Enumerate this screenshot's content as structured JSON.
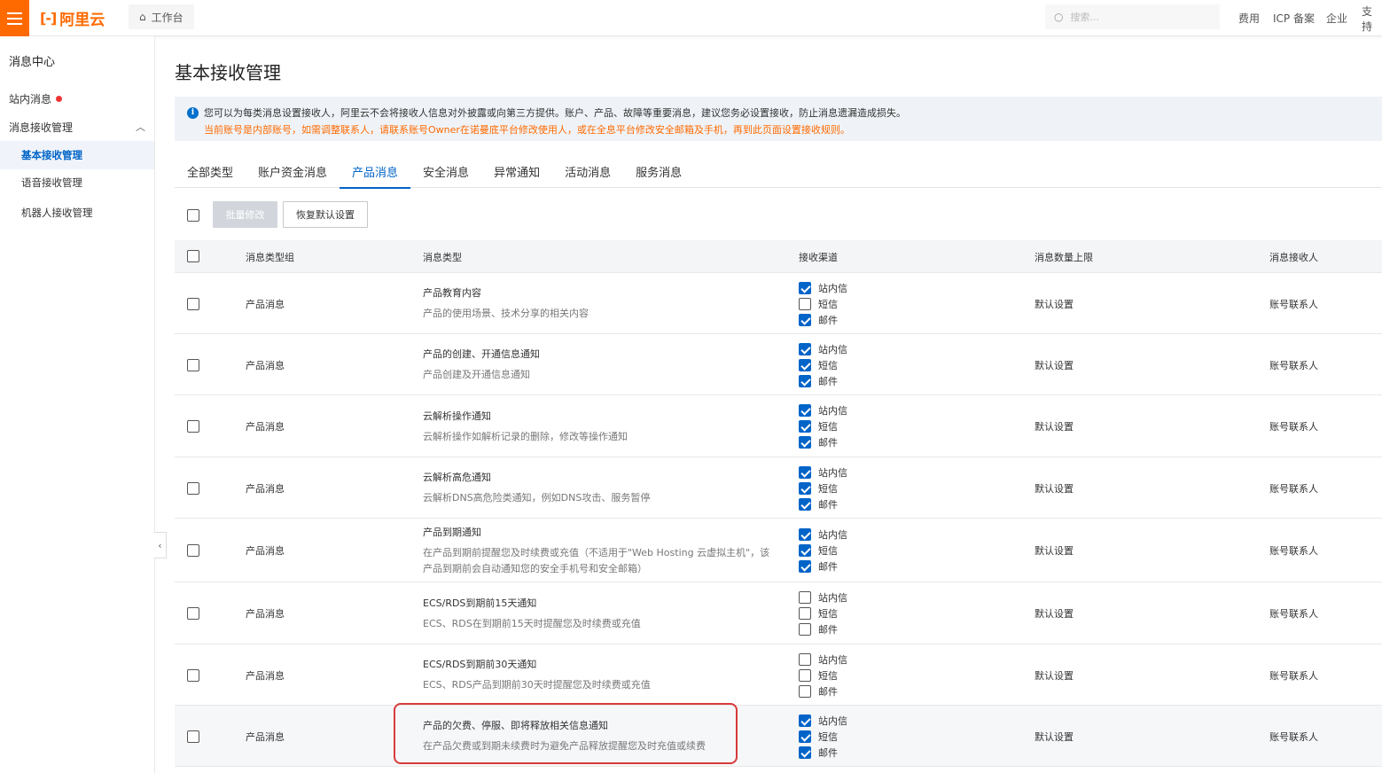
{
  "topbar": {
    "logo_text": "阿里云",
    "logo_mark": "[-]",
    "workbench": "工作台",
    "search_placeholder": "搜索...",
    "links": [
      "费用",
      "ICP 备案",
      "企业",
      "支持"
    ]
  },
  "sidebar": {
    "title": "消息中心",
    "inbox": "站内消息",
    "group": "消息接收管理",
    "items": [
      "基本接收管理",
      "语音接收管理",
      "机器人接收管理"
    ]
  },
  "page": {
    "title": "基本接收管理",
    "notice_line1": "您可以为每类消息设置接收人，阿里云不会将接收人信息对外披露或向第三方提供。账户、产品、故障等重要消息，建议您务必设置接收，防止消息遗漏造成损失。",
    "notice_line2": "当前账号是内部账号，如需调整联系人，请联系账号Owner在诺曼底平台修改使用人，或在全息平台修改安全邮箱及手机，再到此页面设置接收规则。"
  },
  "tabs": [
    "全部类型",
    "账户资金消息",
    "产品消息",
    "安全消息",
    "异常通知",
    "活动消息",
    "服务消息"
  ],
  "active_tab": "产品消息",
  "toolbar": {
    "batch_edit": "批量修改",
    "restore_default": "恢复默认设置"
  },
  "table": {
    "headers": [
      "消息类型组",
      "消息类型",
      "接收渠道",
      "消息数量上限",
      "消息接收人"
    ],
    "channels": [
      "站内信",
      "短信",
      "邮件"
    ],
    "rows": [
      {
        "group": "产品消息",
        "title": "产品教育内容",
        "desc": "产品的使用场景、技术分享的相关内容",
        "checks": [
          true,
          false,
          true
        ],
        "limit": "默认设置",
        "receiver": "账号联系人"
      },
      {
        "group": "产品消息",
        "title": "产品的创建、开通信息通知",
        "desc": "产品创建及开通信息通知",
        "checks": [
          true,
          true,
          true
        ],
        "limit": "默认设置",
        "receiver": "账号联系人"
      },
      {
        "group": "产品消息",
        "title": "云解析操作通知",
        "desc": "云解析操作如解析记录的删除，修改等操作通知",
        "checks": [
          true,
          true,
          true
        ],
        "limit": "默认设置",
        "receiver": "账号联系人"
      },
      {
        "group": "产品消息",
        "title": "云解析高危通知",
        "desc": "云解析DNS高危险类通知，例如DNS攻击、服务暂停",
        "checks": [
          true,
          true,
          true
        ],
        "limit": "默认设置",
        "receiver": "账号联系人"
      },
      {
        "group": "产品消息",
        "title": "产品到期通知",
        "desc": "在产品到期前提醒您及时续费或充值（不适用于\"Web Hosting 云虚拟主机\"，该产品到期前会自动通知您的安全手机号和安全邮箱）",
        "checks": [
          true,
          true,
          true
        ],
        "limit": "默认设置",
        "receiver": "账号联系人"
      },
      {
        "group": "产品消息",
        "title": "ECS/RDS到期前15天通知",
        "desc": "ECS、RDS在到期前15天时提醒您及时续费或充值",
        "checks": [
          false,
          false,
          false
        ],
        "limit": "默认设置",
        "receiver": "账号联系人"
      },
      {
        "group": "产品消息",
        "title": "ECS/RDS到期前30天通知",
        "desc": "ECS、RDS产品到期前30天时提醒您及时续费或充值",
        "checks": [
          false,
          false,
          false
        ],
        "limit": "默认设置",
        "receiver": "账号联系人"
      },
      {
        "group": "产品消息",
        "title": "产品的欠费、停服、即将释放相关信息通知",
        "desc": "在产品欠费或到期未续费时为避免产品释放提醒您及时充值或续费",
        "checks": [
          true,
          true,
          true
        ],
        "limit": "默认设置",
        "receiver": "账号联系人"
      }
    ]
  },
  "colors": {
    "brand": "#ff6a00",
    "primary": "#0064c8",
    "highlight": "#d93a3a"
  }
}
